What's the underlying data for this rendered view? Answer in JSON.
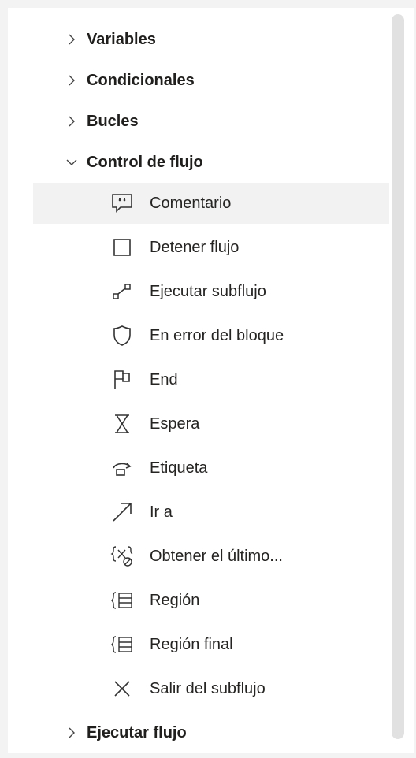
{
  "tree": {
    "groups": [
      {
        "label": "Variables",
        "expanded": false
      },
      {
        "label": "Condicionales",
        "expanded": false
      },
      {
        "label": "Bucles",
        "expanded": false
      },
      {
        "label": "Control de flujo",
        "expanded": true
      },
      {
        "label": "Ejecutar flujo",
        "expanded": false
      }
    ],
    "control_de_flujo_items": [
      {
        "label": "Comentario",
        "icon": "comment-icon",
        "highlighted": true
      },
      {
        "label": "Detener flujo",
        "icon": "stop-flow-icon"
      },
      {
        "label": "Ejecutar subflujo",
        "icon": "run-subflow-icon"
      },
      {
        "label": "En error del bloque",
        "icon": "shield-icon"
      },
      {
        "label": "End",
        "icon": "flag-icon"
      },
      {
        "label": "Espera",
        "icon": "hourglass-icon"
      },
      {
        "label": "Etiqueta",
        "icon": "label-icon"
      },
      {
        "label": "Ir a",
        "icon": "goto-arrow-icon"
      },
      {
        "label": "Obtener el último...",
        "icon": "variable-error-icon"
      },
      {
        "label": "Región",
        "icon": "region-icon"
      },
      {
        "label": "Región final",
        "icon": "end-region-icon"
      },
      {
        "label": "Salir del subflujo",
        "icon": "close-icon"
      }
    ]
  },
  "colors": {
    "panel_bg": "#ffffff",
    "page_bg": "#f3f3f3",
    "hover_bg": "#f2f2f2",
    "text": "#201f1e",
    "scrollbar": "#e1e1e1"
  }
}
